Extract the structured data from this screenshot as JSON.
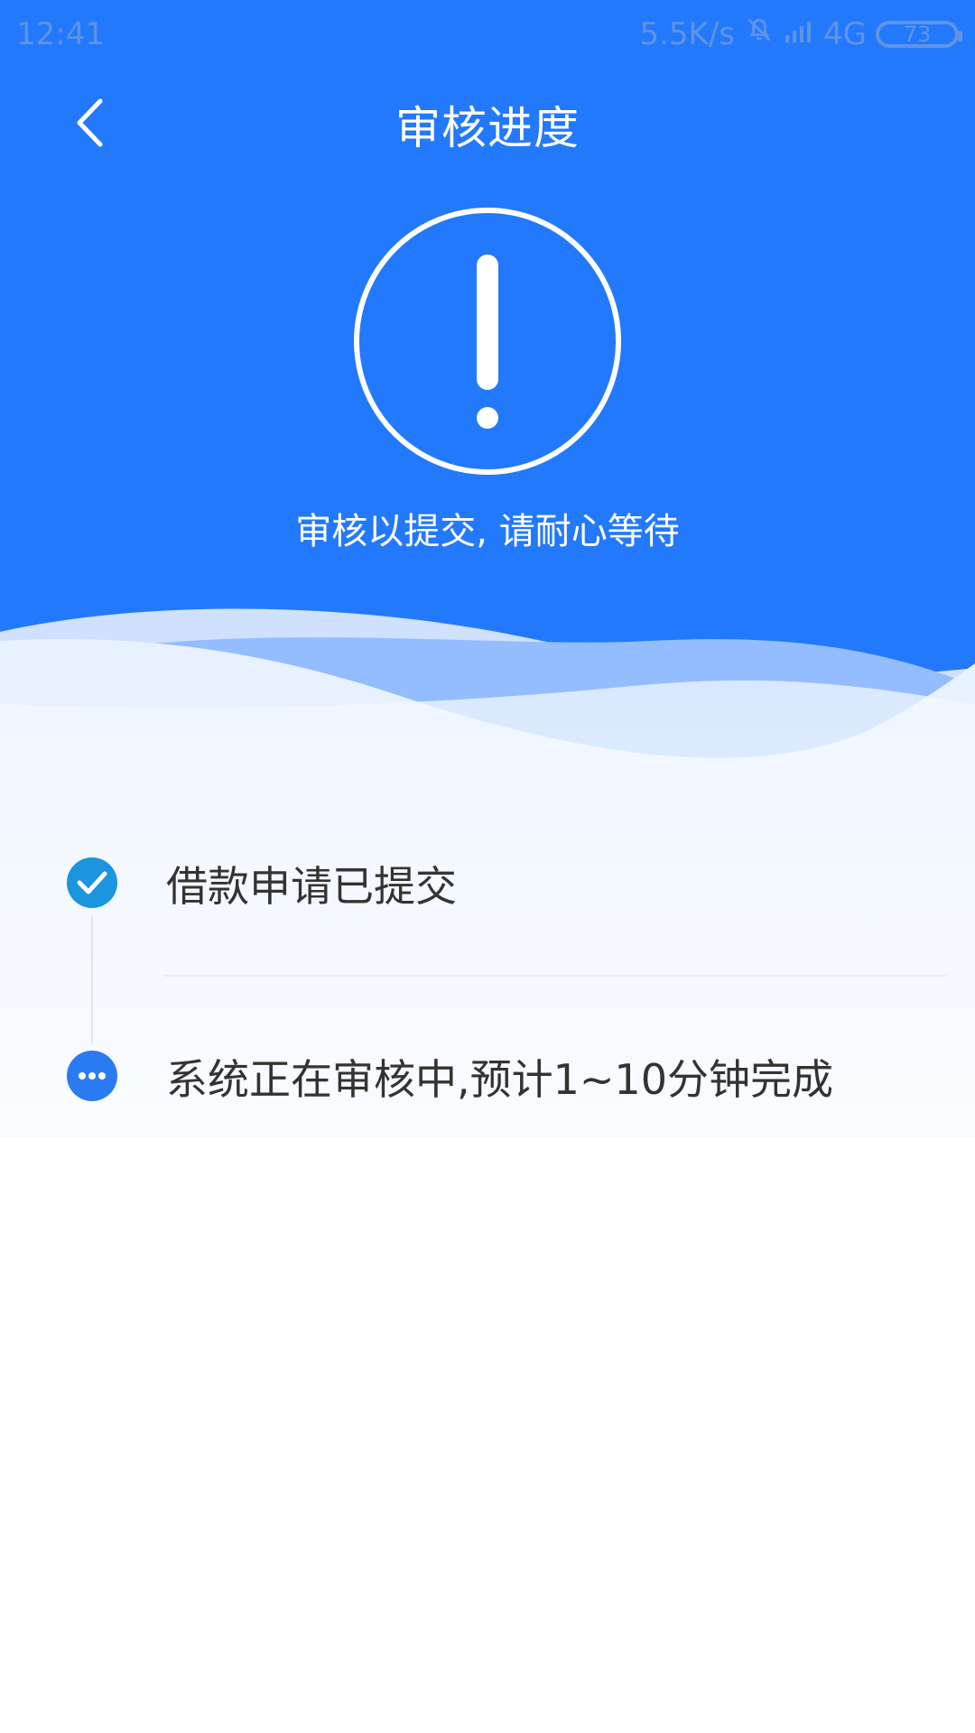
{
  "status_bar": {
    "time": "12:41",
    "network_speed": "5.5K/s",
    "network_type": "4G",
    "battery": "73",
    "icons": [
      "mute-icon",
      "signal-icon",
      "battery-icon"
    ]
  },
  "header": {
    "title": "审核进度",
    "back_icon": "chevron-left-icon"
  },
  "hero": {
    "icon": "alert-icon",
    "message": "审核以提交, 请耐心等待"
  },
  "timeline": {
    "steps": [
      {
        "label": "借款申请已提交",
        "status": "completed",
        "icon": "check-icon"
      },
      {
        "label": "系统正在审核中,预计1~10分钟完成",
        "status": "in-progress",
        "icon": "more-icon"
      }
    ]
  },
  "colors": {
    "primary": "#2379fb",
    "wave_light": "#e8f1fe",
    "wave_mid": "#8fbcff",
    "completed": "#1a95de",
    "progress": "#2a7bf1",
    "text": "#333333",
    "divider": "#e8ebf0"
  }
}
